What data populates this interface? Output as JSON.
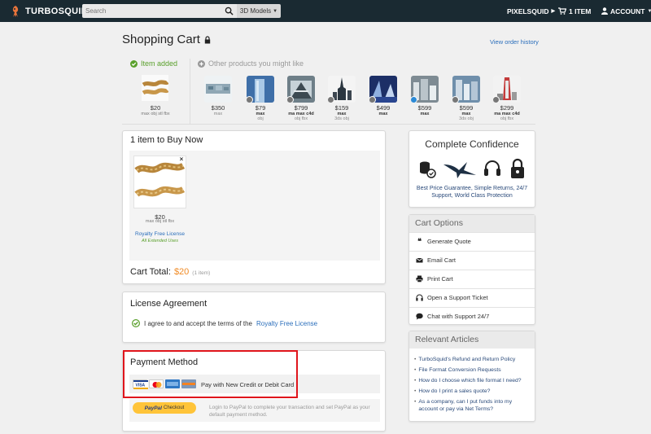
{
  "header": {
    "logo_text": "TURBOSQUID",
    "search_placeholder": "Search",
    "models_select": "3D Models",
    "pixelsquid": "PIXELSQUID",
    "cart_label": "1 ITEM",
    "account_label": "ACCOUNT"
  },
  "page": {
    "title": "Shopping Cart",
    "view_history": "View order history"
  },
  "recent": {
    "added_label": "Item added",
    "added_price": "$20",
    "added_formats": "max obj stl fbx",
    "other_label": "Other products you might like",
    "suggestions": [
      {
        "price": "$350",
        "fmt": "max",
        "fmt2": ""
      },
      {
        "price": "$79",
        "fmt": "max",
        "fmt2": "obj"
      },
      {
        "price": "$799",
        "fmt": "ma max c4d",
        "fmt2": "obj fbx"
      },
      {
        "price": "$159",
        "fmt": "max",
        "fmt2": "3ds obj"
      },
      {
        "price": "$499",
        "fmt": "max",
        "fmt2": ""
      },
      {
        "price": "$599",
        "fmt": "max",
        "fmt2": ""
      },
      {
        "price": "$599",
        "fmt": "max",
        "fmt2": "3ds obj"
      },
      {
        "price": "$299",
        "fmt": "ma max c4d",
        "fmt2": "obj fbx"
      }
    ]
  },
  "cart": {
    "title": "1 item to Buy Now",
    "item_price": "$20",
    "item_formats": "max obj stl fbx",
    "license_link": "Royalty Free License",
    "extended": "All Extended Uses",
    "close": "×",
    "total_label": "Cart Total:",
    "total_value": "$20",
    "total_count": "(1 item)"
  },
  "license": {
    "title": "License Agreement",
    "agree_text": "I agree to and accept the terms of the",
    "agree_link": "Royalty Free License"
  },
  "payment": {
    "title": "Payment Method",
    "new_card": "Pay with New Credit or Debit Card",
    "paypal_btn_brand": "PayPal",
    "paypal_btn_text": "Checkout",
    "paypal_desc": "Login to PayPal to complete your transaction and set PayPal as your default payment method.",
    "card_colors": [
      "#1a3e8f",
      "#eb6a1c",
      "#2e77c4",
      "#7e97b8"
    ]
  },
  "confidence": {
    "title": "Complete Confidence",
    "text": "Best Price Guarantee, Simple Returns, 24/7 Support, World Class Protection"
  },
  "cart_options": {
    "title": "Cart Options",
    "items": [
      "Generate Quote",
      "Email Cart",
      "Print Cart",
      "Open a Support Ticket",
      "Chat with Support 24/7"
    ]
  },
  "articles": {
    "title": "Relevant Articles",
    "items": [
      "TurboSquid's Refund and Return Policy",
      "File Format Conversion Requests",
      "How do I choose which file format I need?",
      "How do I print a sales quote?",
      "As a company, can I put funds into my account or pay via Net Terms?"
    ]
  },
  "colors": {
    "accent_green": "#5aa02c",
    "link_blue": "#2a6ebb",
    "price_orange": "#f08a24",
    "highlight_red": "#e0151c",
    "topbar": "#1a2a32"
  }
}
